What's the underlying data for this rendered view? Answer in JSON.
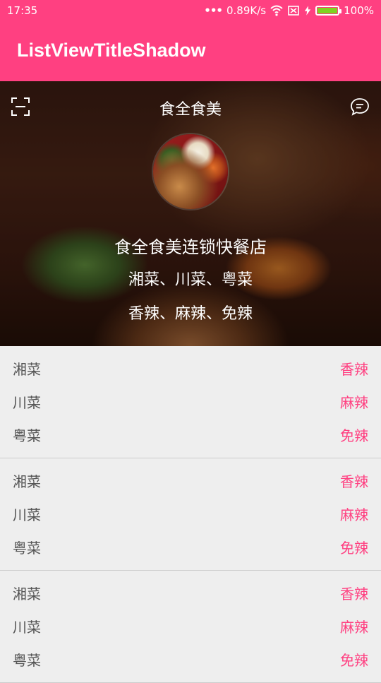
{
  "status_bar": {
    "time": "17:35",
    "speed": "0.89K/s",
    "battery": "100%",
    "battery_level": 1.0
  },
  "app_bar": {
    "title": "ListViewTitleShadow"
  },
  "hero": {
    "title": "食全食美",
    "shop_name": "食全食美连锁快餐店",
    "cuisines": "湘菜、川菜、粤菜",
    "tastes": "香辣、麻辣、免辣"
  },
  "list": {
    "groups": [
      {
        "rows": [
          {
            "name": "湘菜",
            "taste": "香辣"
          },
          {
            "name": "川菜",
            "taste": "麻辣"
          },
          {
            "name": "粤菜",
            "taste": "免辣"
          }
        ]
      },
      {
        "rows": [
          {
            "name": "湘菜",
            "taste": "香辣"
          },
          {
            "name": "川菜",
            "taste": "麻辣"
          },
          {
            "name": "粤菜",
            "taste": "免辣"
          }
        ]
      },
      {
        "rows": [
          {
            "name": "湘菜",
            "taste": "香辣"
          },
          {
            "name": "川菜",
            "taste": "麻辣"
          },
          {
            "name": "粤菜",
            "taste": "免辣"
          }
        ]
      }
    ]
  },
  "colors": {
    "primary": "#ff4081",
    "background": "#eeeeee",
    "item_text": "#555555",
    "accent_text": "#ff4081"
  },
  "icons": {
    "scan": "scan-icon",
    "chat": "chat-icon",
    "wifi": "wifi-icon",
    "sim": "sim-icon",
    "charging": "charging-icon",
    "battery": "battery-icon"
  }
}
